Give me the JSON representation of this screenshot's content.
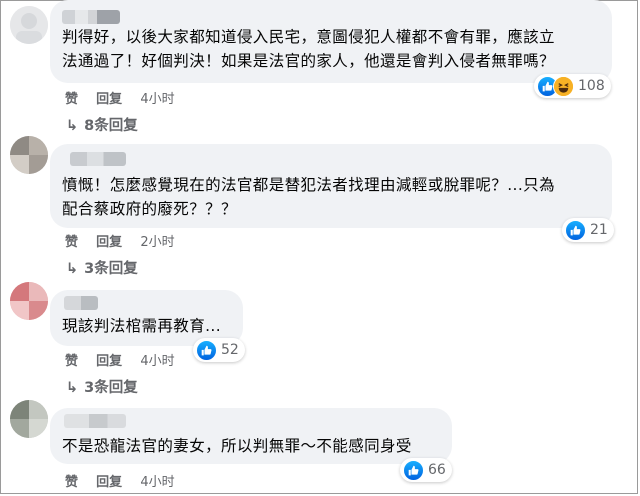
{
  "colors": {
    "like_blue": "#1877f2",
    "bubble_bg": "#f0f2f5",
    "meta_gray": "#65676b",
    "text": "#050505"
  },
  "comments": [
    {
      "lines": [
        "判得好，以後大家都知道侵入民宅，意圖侵犯人權都不會有罪，應該立",
        "法通過了！好個判決！如果是法官的家人，他還是會判入侵者無罪嗎？"
      ],
      "like_label": "赞",
      "reply_label": "回复",
      "time": "4小时",
      "reactions": [
        "like-icon",
        "haha-icon"
      ],
      "reaction_count": "108",
      "replies_label": "8条回复"
    },
    {
      "lines": [
        "憤慨！怎麼感覺現在的法官都是替犯法者找理由減輕或脫罪呢？...只為",
        "配合蔡政府的廢死？？？"
      ],
      "like_label": "赞",
      "reply_label": "回复",
      "time": "2小时",
      "reactions": [
        "like-icon"
      ],
      "reaction_count": "21",
      "replies_label": "3条回复"
    },
    {
      "lines": [
        "現該判法棺需再教育..."
      ],
      "like_label": "赞",
      "reply_label": "回复",
      "time": "4小时",
      "reactions": [
        "like-icon"
      ],
      "reaction_count": "52",
      "replies_label": "3条回复"
    },
    {
      "lines": [
        "不是恐龍法官的妻女，所以判無罪～不能感同身受"
      ],
      "like_label": "赞",
      "reply_label": "回复",
      "time": "4小时",
      "reactions": [
        "like-icon"
      ],
      "reaction_count": "66"
    }
  ]
}
